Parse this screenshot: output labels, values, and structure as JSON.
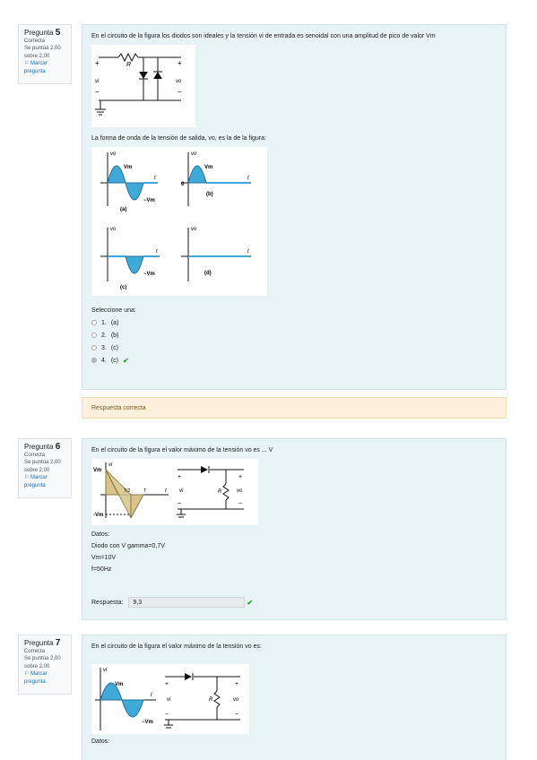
{
  "q5": {
    "info": {
      "label": "Pregunta",
      "number": "5",
      "status": "Correcta",
      "score": "Se puntúa 2,00 sobre 2,00",
      "flag": "Marcar pregunta"
    },
    "text": "En el circuito de la figura los diodos son ideales y la tensión vi de entrada es senoidal con una amplitud de pico de valor Vm",
    "subtext": "La forma de onda de la tensión de salida, vo, es la de la figura:",
    "prompt": "Seleccione una:",
    "options": [
      {
        "num": "1.",
        "label": "(a)"
      },
      {
        "num": "2.",
        "label": "(b)"
      },
      {
        "num": "3.",
        "label": "(c)"
      },
      {
        "num": "4.",
        "label": "(c)"
      }
    ],
    "feedback": "Respuesta correcta"
  },
  "q6": {
    "info": {
      "label": "Pregunta",
      "number": "6",
      "status": "Correcta",
      "score": "Se puntúa 2,00 sobre 2,00",
      "flag": "Marcar pregunta"
    },
    "text": "En el circuito de la figura el valor máximo de la tensión vo es ... V",
    "data_title": "Datos:",
    "data_lines": [
      "Diodo con V gamma=0,7V",
      "Vm=10V",
      "f=50Hz"
    ],
    "answer_label": "Respuesta:",
    "answer_value": "9,3"
  },
  "q7": {
    "info": {
      "label": "Pregunta",
      "number": "7",
      "status": "Correcta",
      "score": "Se puntúa 2,00 sobre 2,00",
      "flag": "Marcar pregunta"
    },
    "text": "En el circuito de la figura el valor máximo de la tensión vo es:",
    "data_title": "Datos:"
  },
  "colors": {
    "panel": "#e7f3f5",
    "feedback": "#fcefdc",
    "wave": "#3fa9d8",
    "triangle": "#d8c48a",
    "check": "#2ca02c"
  }
}
